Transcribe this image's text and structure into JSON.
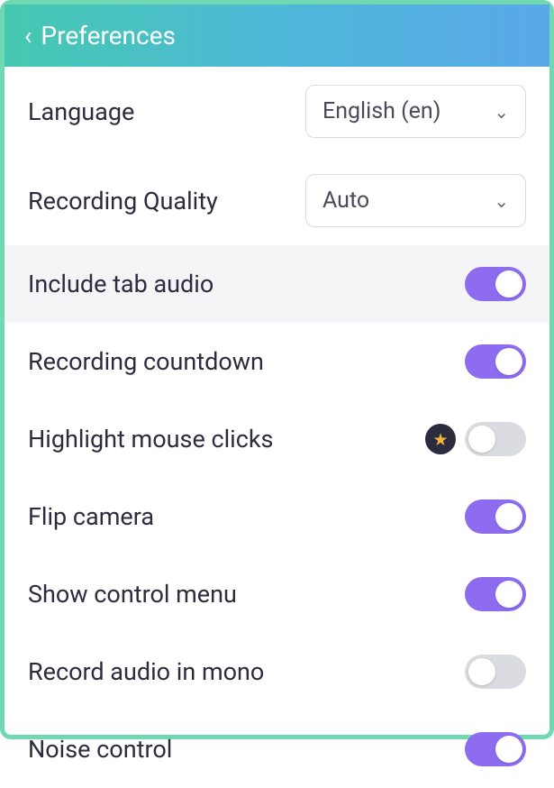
{
  "header": {
    "title": "Preferences"
  },
  "rows": {
    "language": {
      "label": "Language",
      "value": "English (en)"
    },
    "quality": {
      "label": "Recording Quality",
      "value": "Auto"
    },
    "tab_audio": {
      "label": "Include tab audio",
      "on": true
    },
    "countdown": {
      "label": "Recording countdown",
      "on": true
    },
    "highlight_clicks": {
      "label": "Highlight mouse clicks",
      "on": false,
      "premium": true
    },
    "flip_camera": {
      "label": "Flip camera",
      "on": true
    },
    "control_menu": {
      "label": "Show control menu",
      "on": true
    },
    "mono": {
      "label": "Record audio in mono",
      "on": false
    },
    "noise": {
      "label": "Noise control",
      "on": true
    }
  }
}
